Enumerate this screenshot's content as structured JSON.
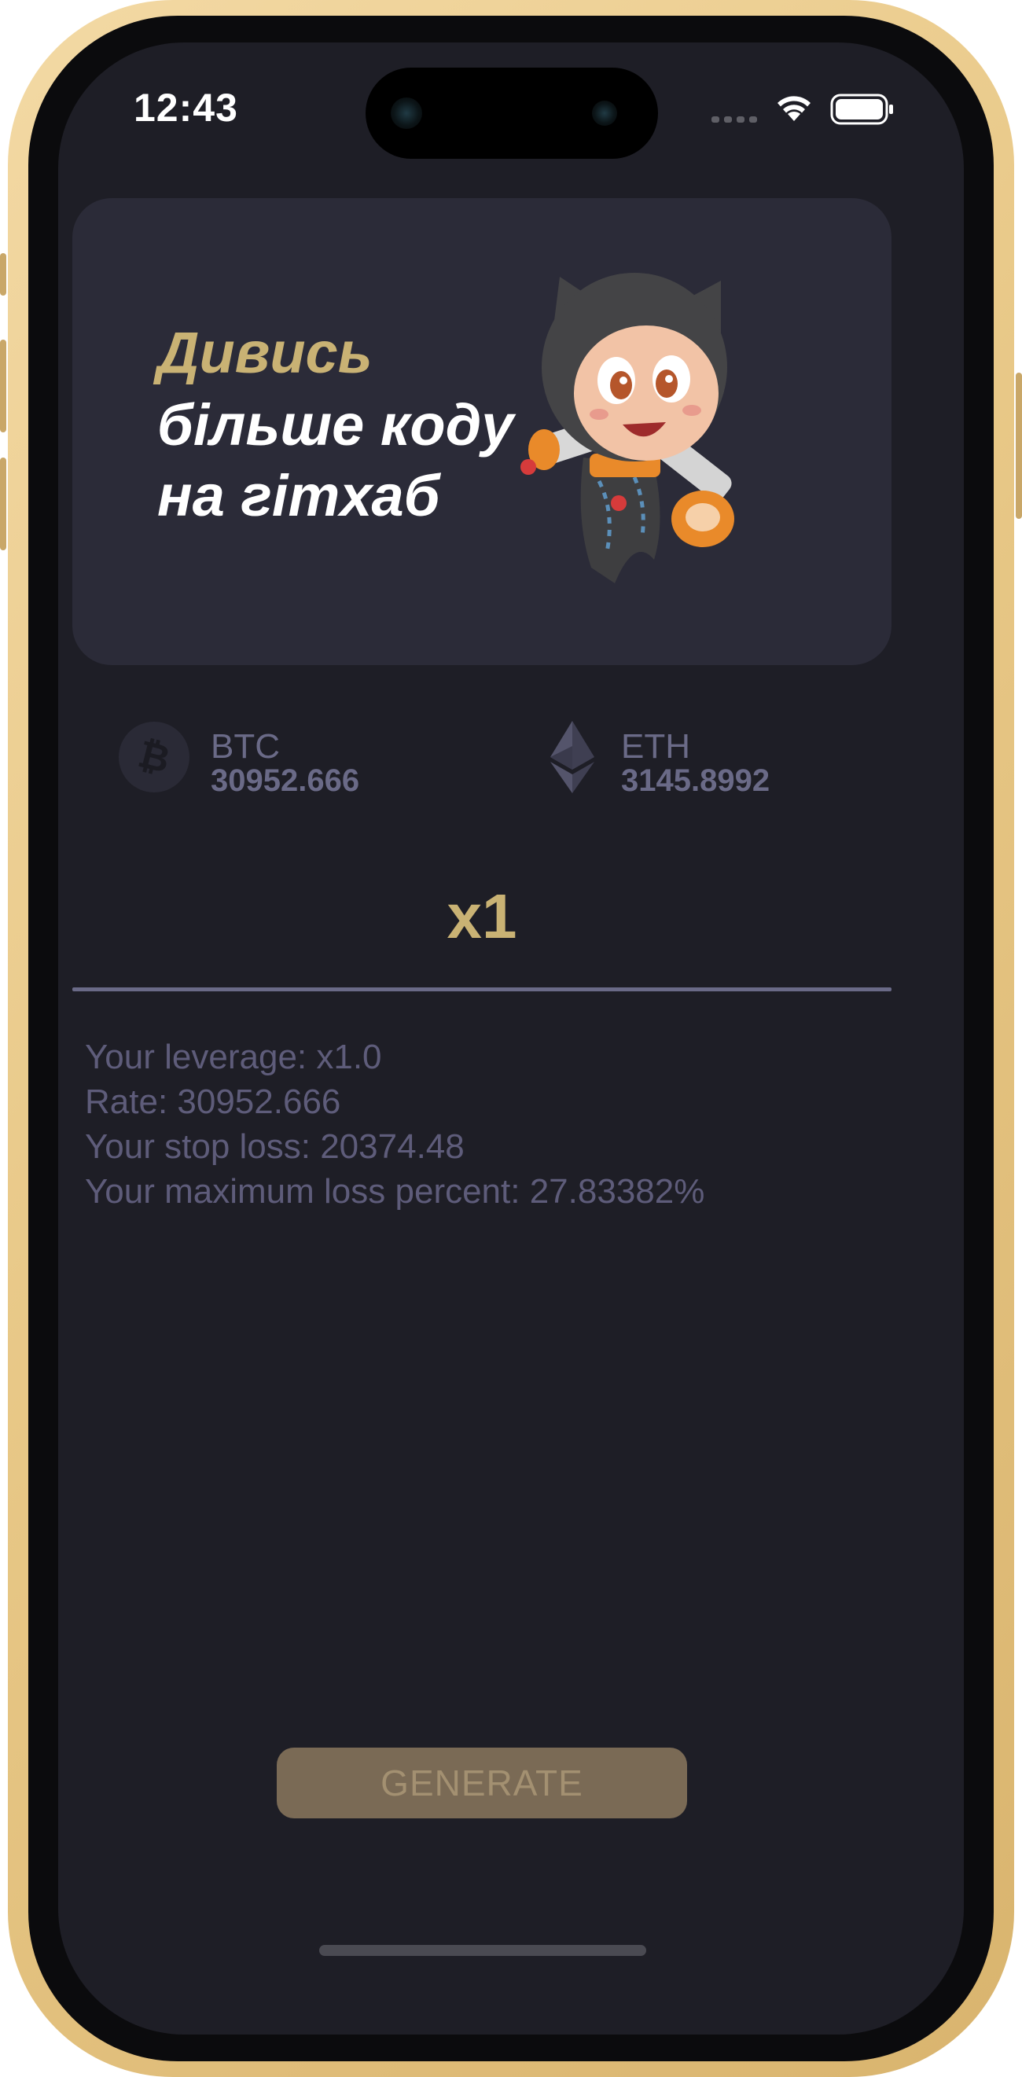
{
  "status_bar": {
    "time": "12:43",
    "icons": [
      "cellular-signal-icon",
      "wifi-icon",
      "battery-icon"
    ]
  },
  "banner": {
    "line1": "Дивись",
    "line2": "більше коду",
    "line3": "на гітхаб",
    "mascot": "octocat-jetpack-illustration"
  },
  "tickers": [
    {
      "symbol": "BTC",
      "price": "30952.666",
      "icon": "bitcoin-icon"
    },
    {
      "symbol": "ETH",
      "price": "3145.8992",
      "icon": "ethereum-icon"
    }
  ],
  "leverage": {
    "value": "x1"
  },
  "info": {
    "leverage_line": "Your leverage: x1.0",
    "rate_line": "Rate: 30952.666",
    "stop_loss_line": "Your stop loss: 20374.48",
    "max_loss_line": "Your maximum loss percent: 27.83382%"
  },
  "actions": {
    "generate_label": "GENERATE"
  },
  "colors": {
    "background": "#1e1e26",
    "card": "#2b2b38",
    "accent_gold": "#c9b274",
    "muted_text": "#6a6a87",
    "button": "#7a6a55",
    "phone_frame": "#e8c887"
  }
}
